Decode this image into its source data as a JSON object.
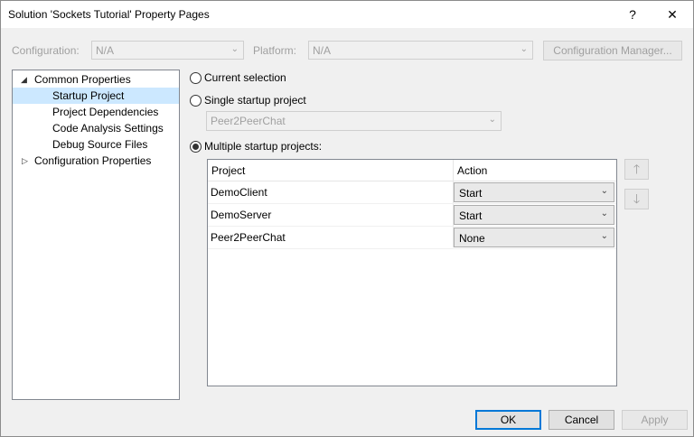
{
  "window": {
    "title": "Solution 'Sockets Tutorial' Property Pages",
    "help_glyph": "?",
    "close_glyph": "✕"
  },
  "top_bar": {
    "configuration_label": "Configuration:",
    "configuration_value": "N/A",
    "platform_label": "Platform:",
    "platform_value": "N/A",
    "config_manager_label": "Configuration Manager..."
  },
  "tree": {
    "items": [
      {
        "label": "Common Properties",
        "expanded": true
      },
      {
        "label": "Startup Project",
        "selected": true
      },
      {
        "label": "Project Dependencies"
      },
      {
        "label": "Code Analysis Settings"
      },
      {
        "label": "Debug Source Files"
      },
      {
        "label": "Configuration Properties",
        "expanded": false
      }
    ]
  },
  "startup": {
    "current_selection_label": "Current selection",
    "single_label": "Single startup project",
    "single_value": "Peer2PeerChat",
    "multiple_label": "Multiple startup projects:",
    "selected_option": "multiple"
  },
  "grid": {
    "columns": [
      "Project",
      "Action"
    ],
    "rows": [
      {
        "project": "DemoClient",
        "action": "Start"
      },
      {
        "project": "DemoServer",
        "action": "Start"
      },
      {
        "project": "Peer2PeerChat",
        "action": "None"
      }
    ]
  },
  "move_buttons": {
    "up_glyph": "🡑",
    "down_glyph": "🡓"
  },
  "footer": {
    "ok_label": "OK",
    "cancel_label": "Cancel",
    "apply_label": "Apply"
  },
  "colors": {
    "accent": "#0078d7",
    "selection": "#cce8ff",
    "disabled_text": "#a0a0a0"
  }
}
